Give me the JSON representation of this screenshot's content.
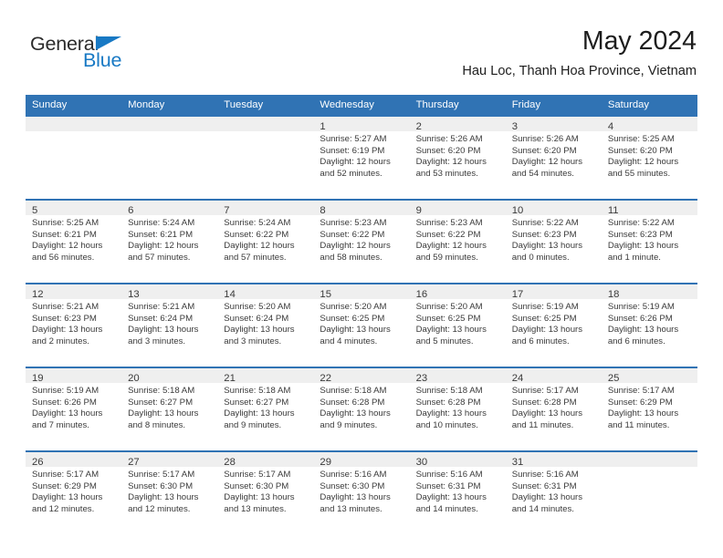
{
  "brand": {
    "word_one": "General",
    "word_two": "Blue",
    "flag_icon": "triangle-flag-icon",
    "accent_color": "#1879c4"
  },
  "header": {
    "month_title": "May 2024",
    "location": "Hau Loc, Thanh Hoa Province, Vietnam"
  },
  "theme": {
    "header_blue": "#3073b4",
    "band_gray": "#efefef",
    "text_dark": "#3a3a3a"
  },
  "calendar": {
    "weekday_headers": [
      "Sunday",
      "Monday",
      "Tuesday",
      "Wednesday",
      "Thursday",
      "Friday",
      "Saturday"
    ],
    "weeks": [
      [
        {
          "day": "",
          "empty": true,
          "lines": []
        },
        {
          "day": "",
          "empty": true,
          "lines": []
        },
        {
          "day": "",
          "empty": true,
          "lines": []
        },
        {
          "day": "1",
          "lines": [
            "Sunrise: 5:27 AM",
            "Sunset: 6:19 PM",
            "Daylight: 12 hours",
            "and 52 minutes."
          ]
        },
        {
          "day": "2",
          "lines": [
            "Sunrise: 5:26 AM",
            "Sunset: 6:20 PM",
            "Daylight: 12 hours",
            "and 53 minutes."
          ]
        },
        {
          "day": "3",
          "lines": [
            "Sunrise: 5:26 AM",
            "Sunset: 6:20 PM",
            "Daylight: 12 hours",
            "and 54 minutes."
          ]
        },
        {
          "day": "4",
          "lines": [
            "Sunrise: 5:25 AM",
            "Sunset: 6:20 PM",
            "Daylight: 12 hours",
            "and 55 minutes."
          ]
        }
      ],
      [
        {
          "day": "5",
          "lines": [
            "Sunrise: 5:25 AM",
            "Sunset: 6:21 PM",
            "Daylight: 12 hours",
            "and 56 minutes."
          ]
        },
        {
          "day": "6",
          "lines": [
            "Sunrise: 5:24 AM",
            "Sunset: 6:21 PM",
            "Daylight: 12 hours",
            "and 57 minutes."
          ]
        },
        {
          "day": "7",
          "lines": [
            "Sunrise: 5:24 AM",
            "Sunset: 6:22 PM",
            "Daylight: 12 hours",
            "and 57 minutes."
          ]
        },
        {
          "day": "8",
          "lines": [
            "Sunrise: 5:23 AM",
            "Sunset: 6:22 PM",
            "Daylight: 12 hours",
            "and 58 minutes."
          ]
        },
        {
          "day": "9",
          "lines": [
            "Sunrise: 5:23 AM",
            "Sunset: 6:22 PM",
            "Daylight: 12 hours",
            "and 59 minutes."
          ]
        },
        {
          "day": "10",
          "lines": [
            "Sunrise: 5:22 AM",
            "Sunset: 6:23 PM",
            "Daylight: 13 hours",
            "and 0 minutes."
          ]
        },
        {
          "day": "11",
          "lines": [
            "Sunrise: 5:22 AM",
            "Sunset: 6:23 PM",
            "Daylight: 13 hours",
            "and 1 minute."
          ]
        }
      ],
      [
        {
          "day": "12",
          "lines": [
            "Sunrise: 5:21 AM",
            "Sunset: 6:23 PM",
            "Daylight: 13 hours",
            "and 2 minutes."
          ]
        },
        {
          "day": "13",
          "lines": [
            "Sunrise: 5:21 AM",
            "Sunset: 6:24 PM",
            "Daylight: 13 hours",
            "and 3 minutes."
          ]
        },
        {
          "day": "14",
          "lines": [
            "Sunrise: 5:20 AM",
            "Sunset: 6:24 PM",
            "Daylight: 13 hours",
            "and 3 minutes."
          ]
        },
        {
          "day": "15",
          "lines": [
            "Sunrise: 5:20 AM",
            "Sunset: 6:25 PM",
            "Daylight: 13 hours",
            "and 4 minutes."
          ]
        },
        {
          "day": "16",
          "lines": [
            "Sunrise: 5:20 AM",
            "Sunset: 6:25 PM",
            "Daylight: 13 hours",
            "and 5 minutes."
          ]
        },
        {
          "day": "17",
          "lines": [
            "Sunrise: 5:19 AM",
            "Sunset: 6:25 PM",
            "Daylight: 13 hours",
            "and 6 minutes."
          ]
        },
        {
          "day": "18",
          "lines": [
            "Sunrise: 5:19 AM",
            "Sunset: 6:26 PM",
            "Daylight: 13 hours",
            "and 6 minutes."
          ]
        }
      ],
      [
        {
          "day": "19",
          "lines": [
            "Sunrise: 5:19 AM",
            "Sunset: 6:26 PM",
            "Daylight: 13 hours",
            "and 7 minutes."
          ]
        },
        {
          "day": "20",
          "lines": [
            "Sunrise: 5:18 AM",
            "Sunset: 6:27 PM",
            "Daylight: 13 hours",
            "and 8 minutes."
          ]
        },
        {
          "day": "21",
          "lines": [
            "Sunrise: 5:18 AM",
            "Sunset: 6:27 PM",
            "Daylight: 13 hours",
            "and 9 minutes."
          ]
        },
        {
          "day": "22",
          "lines": [
            "Sunrise: 5:18 AM",
            "Sunset: 6:28 PM",
            "Daylight: 13 hours",
            "and 9 minutes."
          ]
        },
        {
          "day": "23",
          "lines": [
            "Sunrise: 5:18 AM",
            "Sunset: 6:28 PM",
            "Daylight: 13 hours",
            "and 10 minutes."
          ]
        },
        {
          "day": "24",
          "lines": [
            "Sunrise: 5:17 AM",
            "Sunset: 6:28 PM",
            "Daylight: 13 hours",
            "and 11 minutes."
          ]
        },
        {
          "day": "25",
          "lines": [
            "Sunrise: 5:17 AM",
            "Sunset: 6:29 PM",
            "Daylight: 13 hours",
            "and 11 minutes."
          ]
        }
      ],
      [
        {
          "day": "26",
          "lines": [
            "Sunrise: 5:17 AM",
            "Sunset: 6:29 PM",
            "Daylight: 13 hours",
            "and 12 minutes."
          ]
        },
        {
          "day": "27",
          "lines": [
            "Sunrise: 5:17 AM",
            "Sunset: 6:30 PM",
            "Daylight: 13 hours",
            "and 12 minutes."
          ]
        },
        {
          "day": "28",
          "lines": [
            "Sunrise: 5:17 AM",
            "Sunset: 6:30 PM",
            "Daylight: 13 hours",
            "and 13 minutes."
          ]
        },
        {
          "day": "29",
          "lines": [
            "Sunrise: 5:16 AM",
            "Sunset: 6:30 PM",
            "Daylight: 13 hours",
            "and 13 minutes."
          ]
        },
        {
          "day": "30",
          "lines": [
            "Sunrise: 5:16 AM",
            "Sunset: 6:31 PM",
            "Daylight: 13 hours",
            "and 14 minutes."
          ]
        },
        {
          "day": "31",
          "lines": [
            "Sunrise: 5:16 AM",
            "Sunset: 6:31 PM",
            "Daylight: 13 hours",
            "and 14 minutes."
          ]
        },
        {
          "day": "",
          "empty": true,
          "lines": []
        }
      ]
    ]
  }
}
